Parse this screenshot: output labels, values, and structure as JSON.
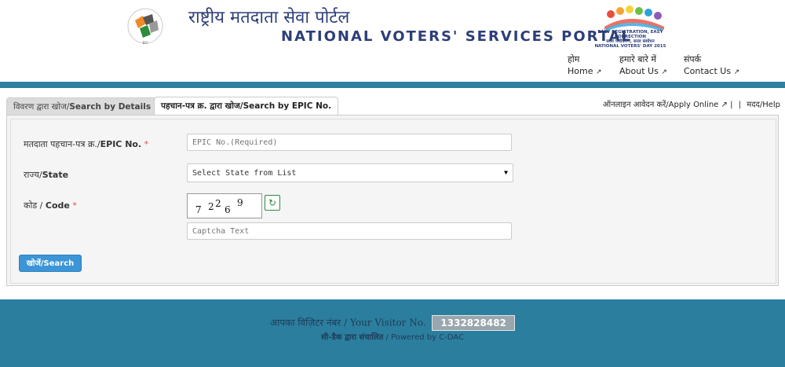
{
  "header": {
    "title_hi": "राष्ट्रीय मतदाता सेवा पोर्टल",
    "title_en": "NATIONAL VOTERS' SERVICES PORTAL",
    "nvd_tagline_1": "EASY REGISTRATION, EASY CORRECTION",
    "nvd_tagline_2": "सरल पंजीकरण, सरल संशोधन",
    "nvd_tagline_3": "NATIONAL VOTERS' DAY 2015"
  },
  "nav": [
    {
      "label_hi": "होम",
      "label_en": "Home",
      "icon": "external-link-icon"
    },
    {
      "label_hi": "हमारे बारे में",
      "label_en": "About Us",
      "icon": "external-link-icon"
    },
    {
      "label_hi": "संपर्क",
      "label_en": "Contact Us",
      "icon": "external-link-icon"
    }
  ],
  "tabs": [
    {
      "label_hi": "विवरण द्वारा खोज/",
      "label_en": "Search by Details",
      "active": false
    },
    {
      "label_hi": "पहचान-पत्र क्र. द्वारा खोज/",
      "label_en": "Search by EPIC No.",
      "active": true
    }
  ],
  "help": {
    "apply_online": "ऑनलाइन आवेदन करें/Apply Online",
    "sep": "|",
    "help": "मदद/Help"
  },
  "form": {
    "epic_label": "मतदाता पहचान-पत्र क्र./",
    "epic_label_en": "EPIC No.",
    "epic_placeholder": "EPIC No.(Required)",
    "state_label": "राज्य/",
    "state_label_en": "State",
    "state_selected": "Select State from List",
    "code_label": "कोड / ",
    "code_label_en": "Code",
    "required_mark": "*",
    "captcha_chars": [
      "7",
      "2",
      "2",
      "6",
      "9"
    ],
    "captcha_placeholder": "Captcha Text",
    "search_button": "खोजें/Search"
  },
  "footer": {
    "visitor_label": "आपका विज़िटर नंबर / Your Visitor No.",
    "visitor_count": "1332828482",
    "powered_hi": "सी-डैक द्वारा संचालित",
    "powered_en": " / Powered by C-DAC"
  },
  "colors": {
    "brand_blue": "#2d3e78",
    "bar_teal": "#2e7fa0",
    "footer_teal": "#2c7e9e",
    "button_blue": "#3b95d6",
    "required_red": "#d9534f"
  }
}
